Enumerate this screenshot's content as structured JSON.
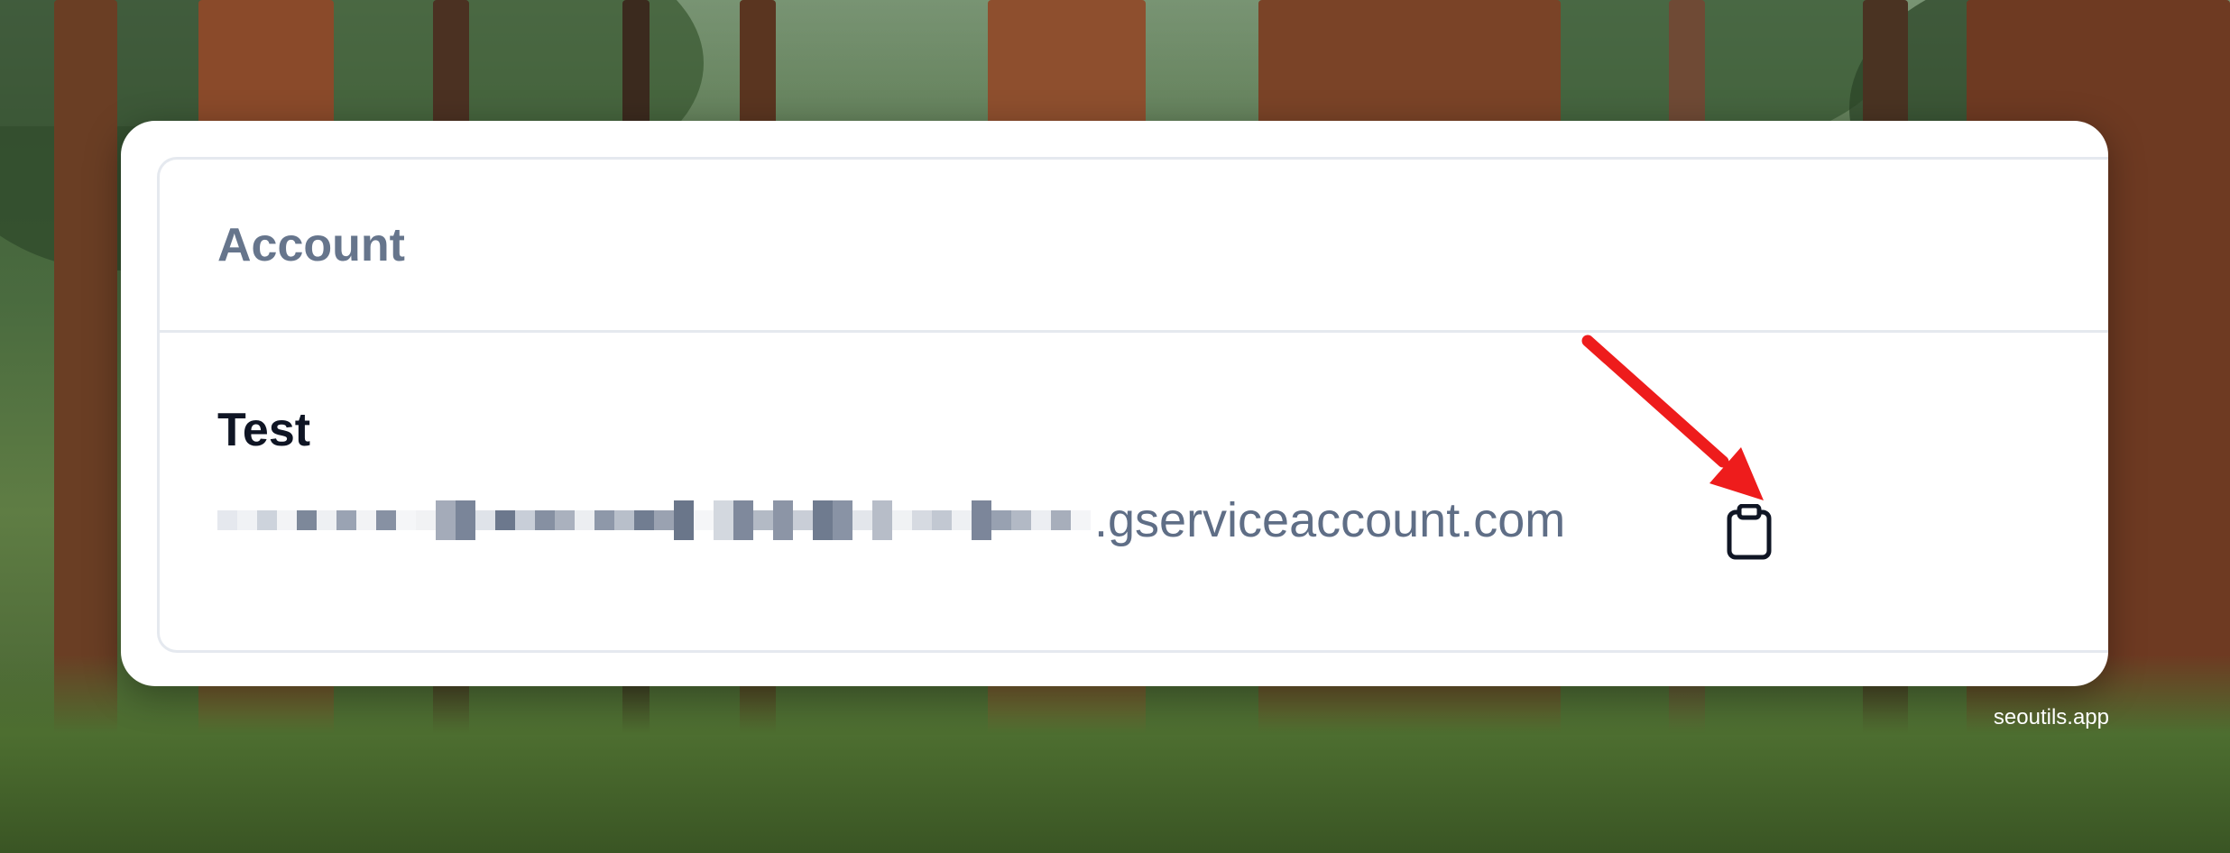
{
  "card": {
    "title": "Account",
    "account_name": "Test",
    "email_visible_part": ".gserviceaccount.com",
    "email_prefix_redacted": true
  },
  "icons": {
    "copy": "clipboard-icon",
    "annotation": "red-arrow"
  },
  "watermark": "seoutils.app",
  "colors": {
    "header_text": "#66758c",
    "name_text": "#0f1524",
    "email_text": "#5f6e86",
    "arrow": "#ee1c1c"
  }
}
